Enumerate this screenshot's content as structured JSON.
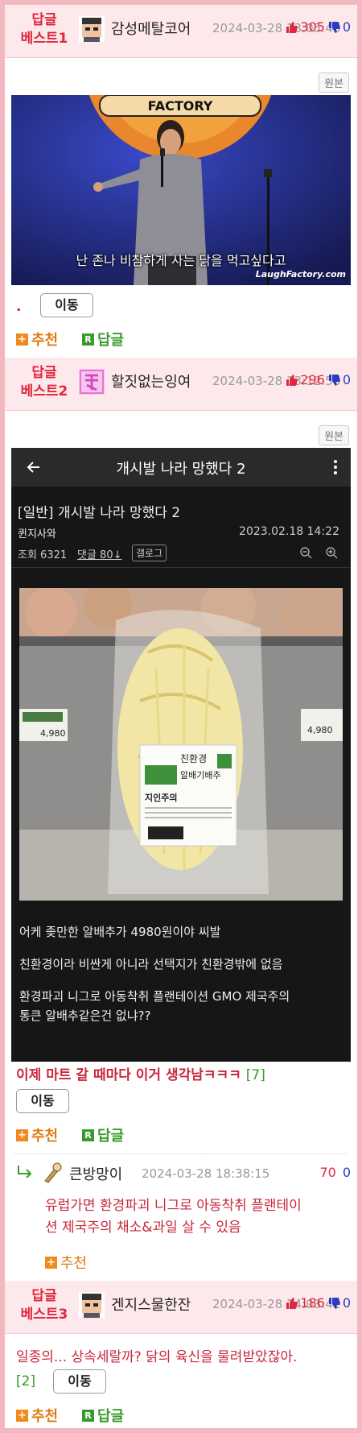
{
  "posts": [
    {
      "best_label": "답글\n베스트1",
      "best_line1": "답글",
      "best_line2": "베스트1",
      "nickname": "감성메탈코어",
      "date": "2024-03-28 13:05:48",
      "up": "305",
      "down": "0",
      "original_button": "원본",
      "image_caption": "난 존나 비참하게 사는 닭을 먹고싶다고",
      "image_watermark": "LaughFactory.com",
      "image_sign": "FACTORY",
      "text": ".",
      "move_button": "이동",
      "recommend": "추천",
      "reply": "답글"
    },
    {
      "best_line1": "답글",
      "best_line2": "베스트2",
      "nickname": "할짓없는잉여",
      "date": "2024-03-28 13:12:58",
      "up": "296",
      "down": "0",
      "original_button": "원본",
      "shot": {
        "bar_title": "개시발 나라 망했다 2",
        "post_title": "[일반] 개시발 나라 망했다 2",
        "author": "퀸지사와",
        "post_date": "2023.02.18 14:22",
        "views": "조회 6321",
        "comments": "댓글 80↓",
        "gallery": "갤로그",
        "label_brand": "친환경",
        "label_product": "알배기배추",
        "label_maker": "지인주의",
        "line1": "어케 좆만한 알배추가 4980원이야 씨발",
        "line2": "친환경이라 비싼게 아니라 선택지가 친환경밖에 없음",
        "line3": "환경파괴 니그로 아동착취 플랜테이션 GMO 제국주의",
        "line4": "통큰 알배추같은건 없냐??",
        "price": "4,980"
      },
      "text": "이제 마트 갈 때마다 이거 생각남ㅋㅋㅋ",
      "reply_count": "[7]",
      "move_button": "이동",
      "recommend": "추천",
      "reply": "답글",
      "sub_reply": {
        "nickname": "큰방망이",
        "date": "2024-03-28 18:38:15",
        "up": "70",
        "down": "0",
        "text_line1": "유럽가면 환경파괴 니그로 아동착취 플랜테이",
        "text_line2": "션 제국주의 채소&과일 살 수 있음",
        "recommend": "추천"
      }
    },
    {
      "best_line1": "답글",
      "best_line2": "베스트3",
      "nickname": "겐지스물한잔",
      "date": "2024-03-28 14:03:41",
      "up": "186",
      "down": "0",
      "text": "일종의... 상속세랄까? 닭의 육신을 물려받았잖아.",
      "reply_count": "[2]",
      "move_button": "이동",
      "recommend": "추천",
      "reply": "답글"
    }
  ],
  "colors": {
    "accent": "#e0273e",
    "border_pink": "#f3b8bf",
    "head_bg": "#fde9eb",
    "recommend": "#e07b13",
    "reply": "#3a9a2d",
    "down_vote": "#2b3cc4"
  }
}
